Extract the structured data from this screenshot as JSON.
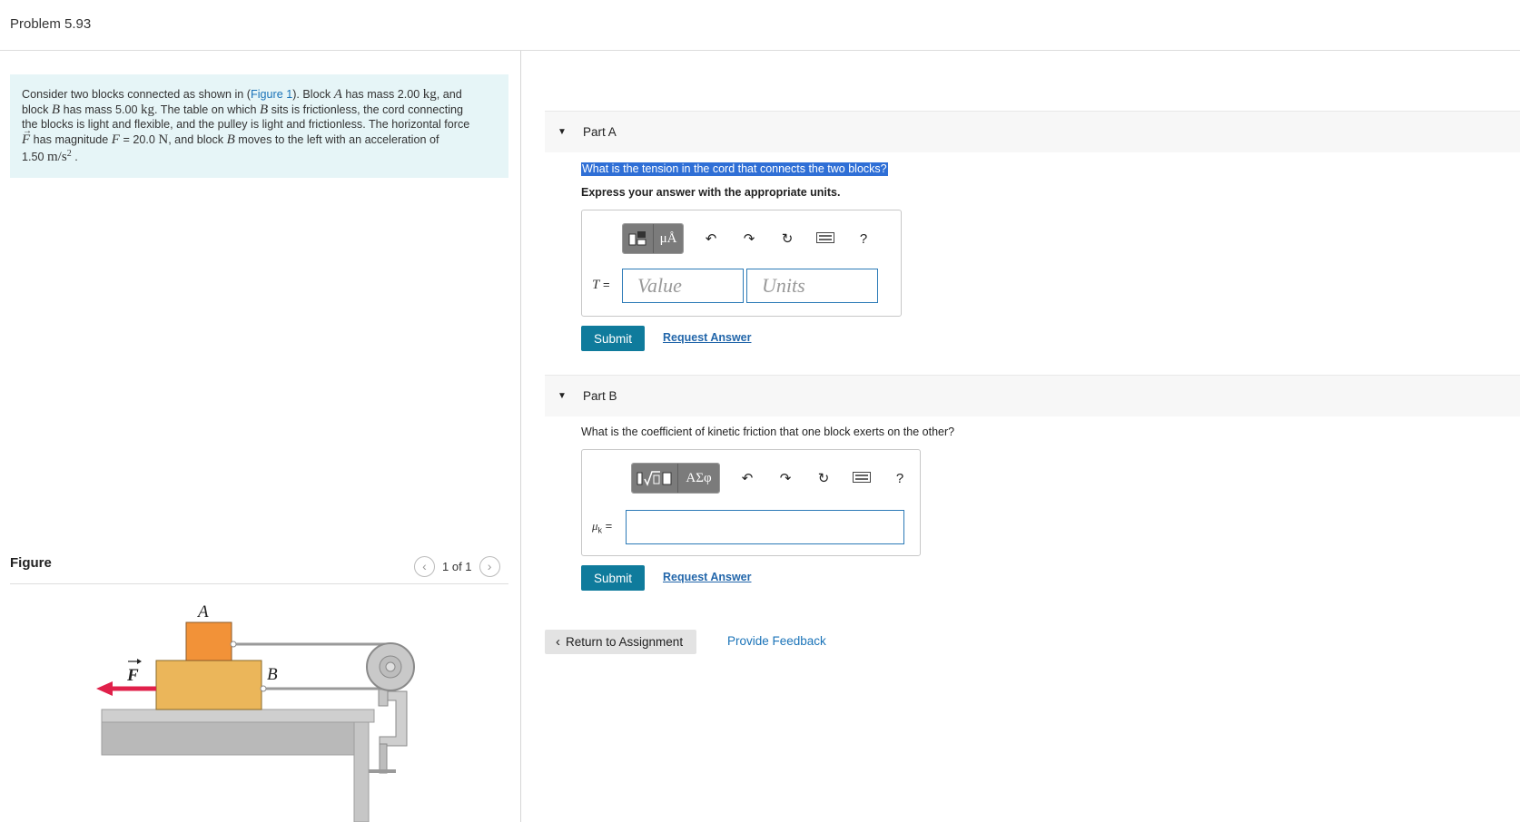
{
  "header": {
    "title": "Problem 5.93"
  },
  "problem": {
    "t1": "Consider two blocks connected as shown in (",
    "figure_link": "Figure 1",
    "t2": "). Block ",
    "blockA": "A",
    "t3": " has mass 2.00 ",
    "unit_kg": "kg",
    "t4": ", and",
    "t5": "block ",
    "blockB": "B",
    "t6": " has mass 5.00 ",
    "t7": ". The table on which ",
    "t8": " sits is frictionless, the cord connecting",
    "t9": "the blocks is light and flexible, and the pulley is light and frictionless. The horizontal force",
    "force_symbol": "F",
    "t10": " has magnitude ",
    "force_var": "F",
    "t11": " = 20.0 ",
    "unit_N": "N",
    "t12": ", and block ",
    "t13": " moves to the left with an acceleration of",
    "t14": "1.50 ",
    "unit_accel": "m/s",
    "unit_exp": "2",
    "t15": " ."
  },
  "figure": {
    "label": "Figure",
    "pager": "1 of 1",
    "label_A": "A",
    "label_B": "B",
    "label_F": "F"
  },
  "partA": {
    "label": "Part A",
    "question": "What is the tension in the cord that connects the two blocks?",
    "instruction": "Express your answer with the appropriate units.",
    "mu_a": "μÅ",
    "variable": "T",
    "equals": " =",
    "value_placeholder": "Value",
    "units_placeholder": "Units",
    "help": "?",
    "submit": "Submit",
    "request": "Request Answer"
  },
  "partB": {
    "label": "Part B",
    "question": "What is the coefficient of kinetic friction that one block exerts on the other?",
    "greek": "ΑΣφ",
    "variable": "μ",
    "variable_sub": "k",
    "equals": " =",
    "help": "?",
    "submit": "Submit",
    "request": "Request Answer"
  },
  "footer": {
    "return": "Return to Assignment",
    "feedback": "Provide Feedback"
  }
}
